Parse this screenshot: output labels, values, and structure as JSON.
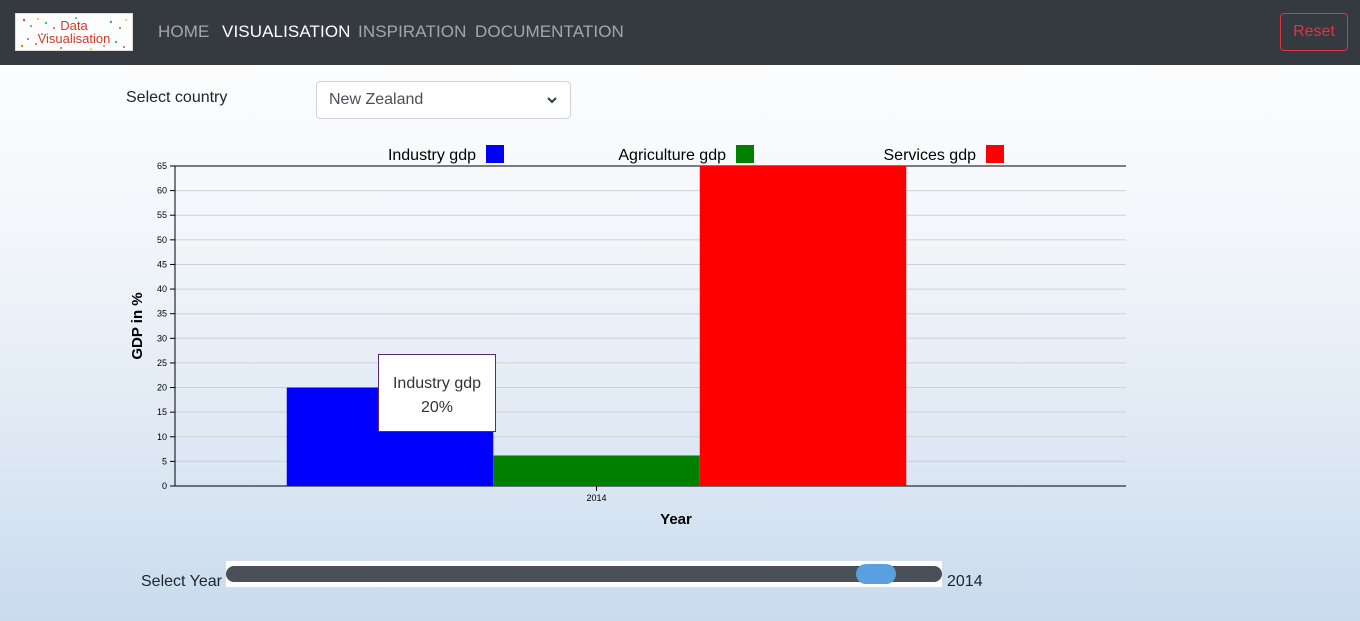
{
  "nav": {
    "logo_line1": "Data",
    "logo_line2": "Visualisation",
    "home": "HOME",
    "visualisation": "VISUALISATION",
    "inspiration": "INSPIRATION",
    "documentation": "DOCUMENTATION",
    "reset": "Reset"
  },
  "country": {
    "label": "Select country",
    "selected": "New Zealand"
  },
  "chart_data": {
    "type": "bar",
    "categories": [
      "2014"
    ],
    "series": [
      {
        "name": "Industry gdp",
        "values": [
          20
        ],
        "color": "#0000ff"
      },
      {
        "name": "Agriculture gdp",
        "values": [
          6.2
        ],
        "color": "#008000"
      },
      {
        "name": "Services gdp",
        "values": [
          65
        ],
        "color": "#ff0000"
      }
    ],
    "xlabel": "Year",
    "ylabel": "GDP in %",
    "ylim": [
      0,
      65
    ],
    "yticks": [
      "0",
      "5",
      "10",
      "15",
      "20",
      "25",
      "30",
      "35",
      "40",
      "45",
      "50",
      "55",
      "60",
      "65"
    ],
    "grid": true,
    "legend": "top"
  },
  "tooltip": {
    "series": "Industry gdp",
    "value": "20%"
  },
  "slider": {
    "label": "Select Year",
    "value": "2014",
    "position": 0.92
  }
}
